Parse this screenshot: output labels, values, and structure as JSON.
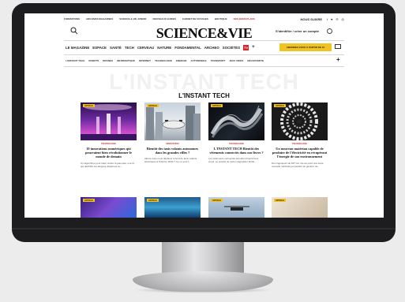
{
  "colors": {
    "accent_red": "#d8232a",
    "accent_yellow": "#f2c320",
    "bezel": "#1d1d1f"
  },
  "topbar": {
    "links": [
      "FORMATIONS",
      "ARCHIVES MAGAZINES",
      "SCIENCE & VIE JUNIOR",
      "NOUVEAUX GUIDES",
      "CARNET DE VOYAGES",
      "BOUTIQUE",
      "JEUX-CONCOURS"
    ],
    "highlight": "NOS BONS PLANS",
    "follow": "NOUS SUIVRE",
    "social_icons": [
      "facebook-icon",
      "twitter-icon",
      "pinterest-icon",
      "instagram-icon"
    ]
  },
  "header": {
    "logo": "SCIENCE&VIE",
    "login": "S'identifier / créer un compte",
    "search_icon": "search-icon",
    "user_icon": "user-icon"
  },
  "main_nav": {
    "items": [
      "LE MAGAZINE",
      "ESPACE",
      "SANTÉ",
      "TECH",
      "CERVEAU",
      "NATURE",
      "FONDAMENTAL",
      "ARCHEO",
      "SOCIÉTÉS"
    ],
    "tv_badge": "TV",
    "more": "+",
    "subscribe": "ABONNEZ-VOUS À PARTIR DE 1€",
    "mail_icon": "mail-icon"
  },
  "sub_nav": {
    "items": [
      "L'INSTANT TECH",
      "ROBOTS",
      "DRONES",
      "INFORMATIQUE",
      "INTERNET",
      "TECHNOLOGIE",
      "ENERGIE",
      "AUTOMOBILE",
      "TRANSPORT",
      "JEUX VIDÉO",
      "DÉCOUVERTE"
    ],
    "more": "+"
  },
  "section": {
    "ghost_title": "L'INSTANT TECH",
    "title": "L'INSTANT TECH"
  },
  "cards": [
    {
      "tag": "ARTICLE",
      "category": "TECHNOLOGIE",
      "title": "10 innovations numériques qui pourraient bien révolutionner le monde de demain",
      "desc": "Un algorithme pour lutter contre la pauvreté, une IA qui déchiffre les langues disparues ou..."
    },
    {
      "tag": "ARTICLE",
      "category": "INNOVATION",
      "title": "Bientôt des taxis volants autonomes dans les grandes villes ?",
      "desc": "Allons-nous nous déplacer à bord de taxis volants électriques à l'horizon 2030 ? Ce ne sont l..."
    },
    {
      "tag": "ARTICLE",
      "category": "TECHNOLOGIE",
      "title": "L'INSTANT TECH Bientôt des vêtements connectés dans nos livres ?",
      "desc": "Les vêtements connectés prendront bientôt leur envol. Le produit de cette imagination fertile..."
    },
    {
      "tag": "ARTICLE",
      "category": "TECHNOLOGIE",
      "title": "Un nouveau matériau capable de produire de l'électricité en récupérant l'énergie de son environnement",
      "desc": "Des ingénieurs du MIT ont mis au point une toute nouvelle méthode permettant de générer de..."
    }
  ],
  "bottom_cards": [
    {
      "tag": "ARTICLE"
    },
    {
      "tag": "ARTICLE"
    },
    {
      "tag": "ARTICLE"
    },
    {
      "tag": "ARTICLE"
    }
  ]
}
